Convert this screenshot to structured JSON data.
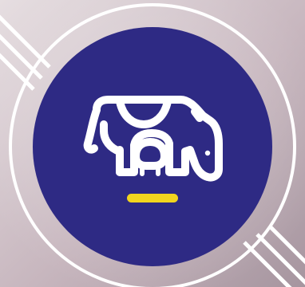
{
  "icon": {
    "name": "cow-dairy-icon",
    "indicator": "accent-bar"
  },
  "colors": {
    "background_light": "#E6DEE1",
    "background_mid": "#C7B6BE",
    "background_dark": "#A6959F",
    "ring": "#FFFFFF",
    "badge": "#2E2A84",
    "icon_stroke": "#FFFFFF",
    "accent": "#F2D51E",
    "stripes": "#FFFFFF"
  }
}
